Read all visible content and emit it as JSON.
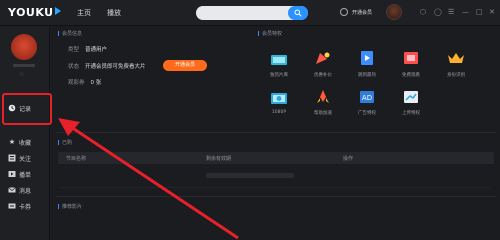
{
  "app": {
    "logo": "YOUKU",
    "nav": [
      "主页",
      "播放"
    ],
    "search": {
      "placeholder": ""
    },
    "vip_label": "开通会员",
    "window_controls": [
      "settings-icon",
      "skin-icon",
      "list-icon",
      "minimize-icon",
      "maximize-icon",
      "close-icon"
    ]
  },
  "sidebar": {
    "vip_star": "☆",
    "items": [
      {
        "label": "记录",
        "icon": "history-icon"
      },
      {
        "label": "收藏",
        "icon": "star-icon"
      },
      {
        "label": "关注",
        "icon": "follow-icon"
      },
      {
        "label": "播单",
        "icon": "playlist-icon"
      },
      {
        "label": "消息",
        "icon": "message-icon"
      },
      {
        "label": "卡券",
        "icon": "coupon-icon"
      }
    ]
  },
  "member_info": {
    "title": "会员信息",
    "rows": [
      {
        "label": "类型",
        "value": "普通用户"
      },
      {
        "label": "状态",
        "value": "开通会员即可免费看大片"
      },
      {
        "label": "观影券",
        "value": "0  张"
      }
    ],
    "open_button": "开通会员"
  },
  "privileges": {
    "title": "会员特权",
    "items": [
      {
        "label": "独凯片库",
        "icon": "film-library-icon"
      },
      {
        "label": "优惠补价",
        "icon": "discount-icon"
      },
      {
        "label": "跳到最热",
        "icon": "skip-ad-icon"
      },
      {
        "label": "免费观看",
        "icon": "free-watch-icon"
      },
      {
        "label": "身份识别",
        "icon": "crown-icon"
      },
      {
        "label": "1080P",
        "icon": "hd-icon"
      },
      {
        "label": "帮助加速",
        "icon": "rocket-icon"
      },
      {
        "label": "广告特权",
        "icon": "ad-icon"
      },
      {
        "label": "上传特权",
        "icon": "upload-icon"
      }
    ]
  },
  "recent": {
    "title": "已购",
    "columns": [
      "节目名称",
      "剩余有效期",
      "操作"
    ]
  },
  "recommend": {
    "title": "推荐影片"
  },
  "colors": {
    "accent_blue": "#2a93ff",
    "vip_orange": "#ff6b1a",
    "highlight_red": "#e8202a",
    "background": "#1b1c20"
  }
}
